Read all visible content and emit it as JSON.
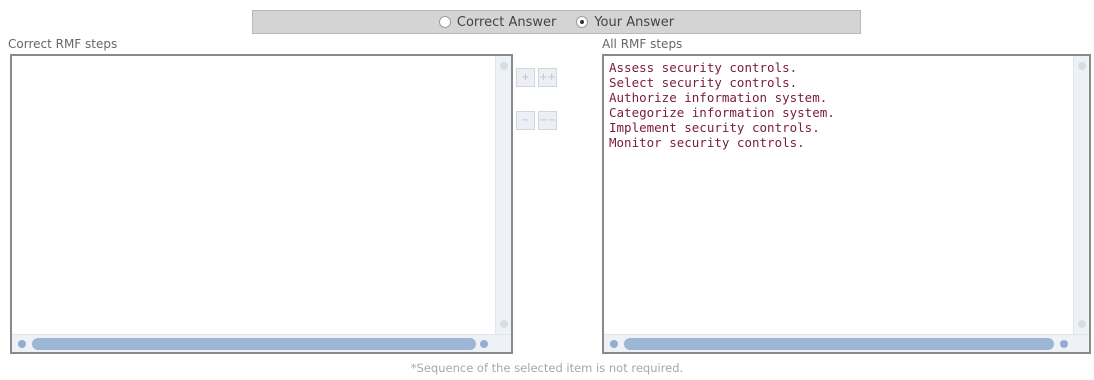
{
  "toggle": {
    "correct_answer_label": "Correct Answer",
    "your_answer_label": "Your Answer",
    "selected": "your_answer"
  },
  "left_panel": {
    "label": "Correct RMF steps",
    "items": []
  },
  "right_panel": {
    "label": "All RMF steps",
    "items": [
      "Assess security controls.",
      "Select security controls.",
      "Authorize information system.",
      "Categorize information system.",
      "Implement security controls.",
      "Monitor security controls."
    ]
  },
  "buttons": {
    "move_up": "+",
    "move_all_up": "++",
    "move_down": "−",
    "move_all_down": "−−"
  },
  "footnote": "*Sequence of the selected item is not required.",
  "colors": {
    "item_text": "#7a1c3a",
    "toggle_bar": "#d4d4d4",
    "scroll_thumb": "#9db6d6"
  }
}
